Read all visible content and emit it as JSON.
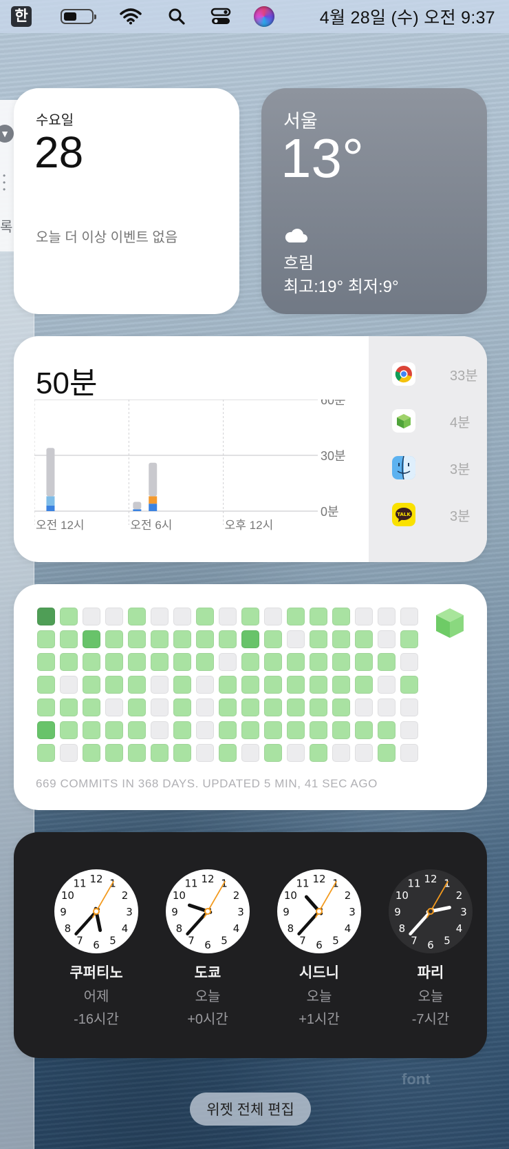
{
  "menubar": {
    "input_source": "한",
    "clock": "4월 28일 (수) 오전  9:37",
    "icons": [
      "input-source-icon",
      "battery-icon",
      "wifi-icon",
      "search-icon",
      "control-center-icon",
      "siri-icon"
    ]
  },
  "sidebar_window": {
    "arrow": "▼",
    "text": "록"
  },
  "calendar": {
    "weekday": "수요일",
    "date": "28",
    "note": "오늘 더 이상 이벤트 없음"
  },
  "weather": {
    "city": "서울",
    "temp": "13°",
    "icon": "cloud-icon",
    "condition": "흐림",
    "range": "최고:19° 최저:9°"
  },
  "screen_time": {
    "total": "50분",
    "chart_data": {
      "type": "bar",
      "title": "",
      "y_ticks": [
        "60분",
        "30분",
        "0분"
      ],
      "ylim": [
        0,
        60
      ],
      "x_ticks": [
        "오전 12시",
        "오전 6시",
        "오후 12시"
      ],
      "series": [
        {
          "name": "",
          "color": "#c9c9ce",
          "values": [
            26,
            0,
            4,
            18
          ]
        },
        {
          "name": "",
          "color": "#f39a2f",
          "values": [
            0,
            0,
            0,
            4
          ]
        },
        {
          "name": "",
          "color": "#3b82e0",
          "values": [
            3,
            0,
            1,
            4
          ]
        },
        {
          "name": "",
          "color": "#7fbde8",
          "values": [
            5,
            0,
            0,
            0
          ]
        }
      ],
      "bar_hours": [
        0.5,
        5.8,
        6.0,
        7.0
      ]
    },
    "apps": [
      {
        "icon": "chrome-icon",
        "value": "33분"
      },
      {
        "icon": "cube-app-icon",
        "value": "4분"
      },
      {
        "icon": "finder-icon",
        "value": "3분"
      },
      {
        "icon": "kakaotalk-icon",
        "value": "3분"
      }
    ]
  },
  "github": {
    "footer": "669 COMMITS IN 368 DAYS. UPDATED 5 MIN, 41 SEC AGO",
    "grid": [
      [
        3,
        1,
        0,
        0,
        1,
        0,
        0,
        1,
        0,
        1,
        0,
        1,
        1,
        1,
        0,
        0,
        0
      ],
      [
        1,
        1,
        2,
        1,
        1,
        1,
        1,
        1,
        1,
        2,
        1,
        0,
        1,
        1,
        1,
        0,
        1
      ],
      [
        1,
        1,
        1,
        1,
        1,
        1,
        1,
        1,
        0,
        1,
        1,
        1,
        1,
        1,
        1,
        1,
        0
      ],
      [
        1,
        0,
        1,
        1,
        1,
        0,
        1,
        0,
        1,
        1,
        1,
        1,
        1,
        1,
        1,
        0,
        1
      ],
      [
        1,
        1,
        1,
        0,
        1,
        0,
        1,
        0,
        1,
        1,
        1,
        1,
        1,
        1,
        0,
        0,
        0
      ],
      [
        2,
        1,
        1,
        1,
        1,
        0,
        1,
        0,
        1,
        1,
        1,
        1,
        1,
        1,
        1,
        1,
        0
      ],
      [
        1,
        0,
        1,
        1,
        1,
        1,
        1,
        0,
        1,
        0,
        1,
        0,
        1,
        0,
        0,
        1,
        0
      ]
    ]
  },
  "world_clock": [
    {
      "city": "쿠퍼티노",
      "day": "어제",
      "offset": "-16시간",
      "hour": 17,
      "minute": 37,
      "second": 5,
      "theme": "light"
    },
    {
      "city": "도쿄",
      "day": "오늘",
      "offset": "+0시간",
      "hour": 9,
      "minute": 37,
      "second": 5,
      "theme": "light"
    },
    {
      "city": "시드니",
      "day": "오늘",
      "offset": "+1시간",
      "hour": 10,
      "minute": 37,
      "second": 5,
      "theme": "light"
    },
    {
      "city": "파리",
      "day": "오늘",
      "offset": "-7시간",
      "hour": 2,
      "minute": 37,
      "second": 5,
      "theme": "dark"
    }
  ],
  "edit_button": "위젯 전체 편집",
  "watermark": "font"
}
